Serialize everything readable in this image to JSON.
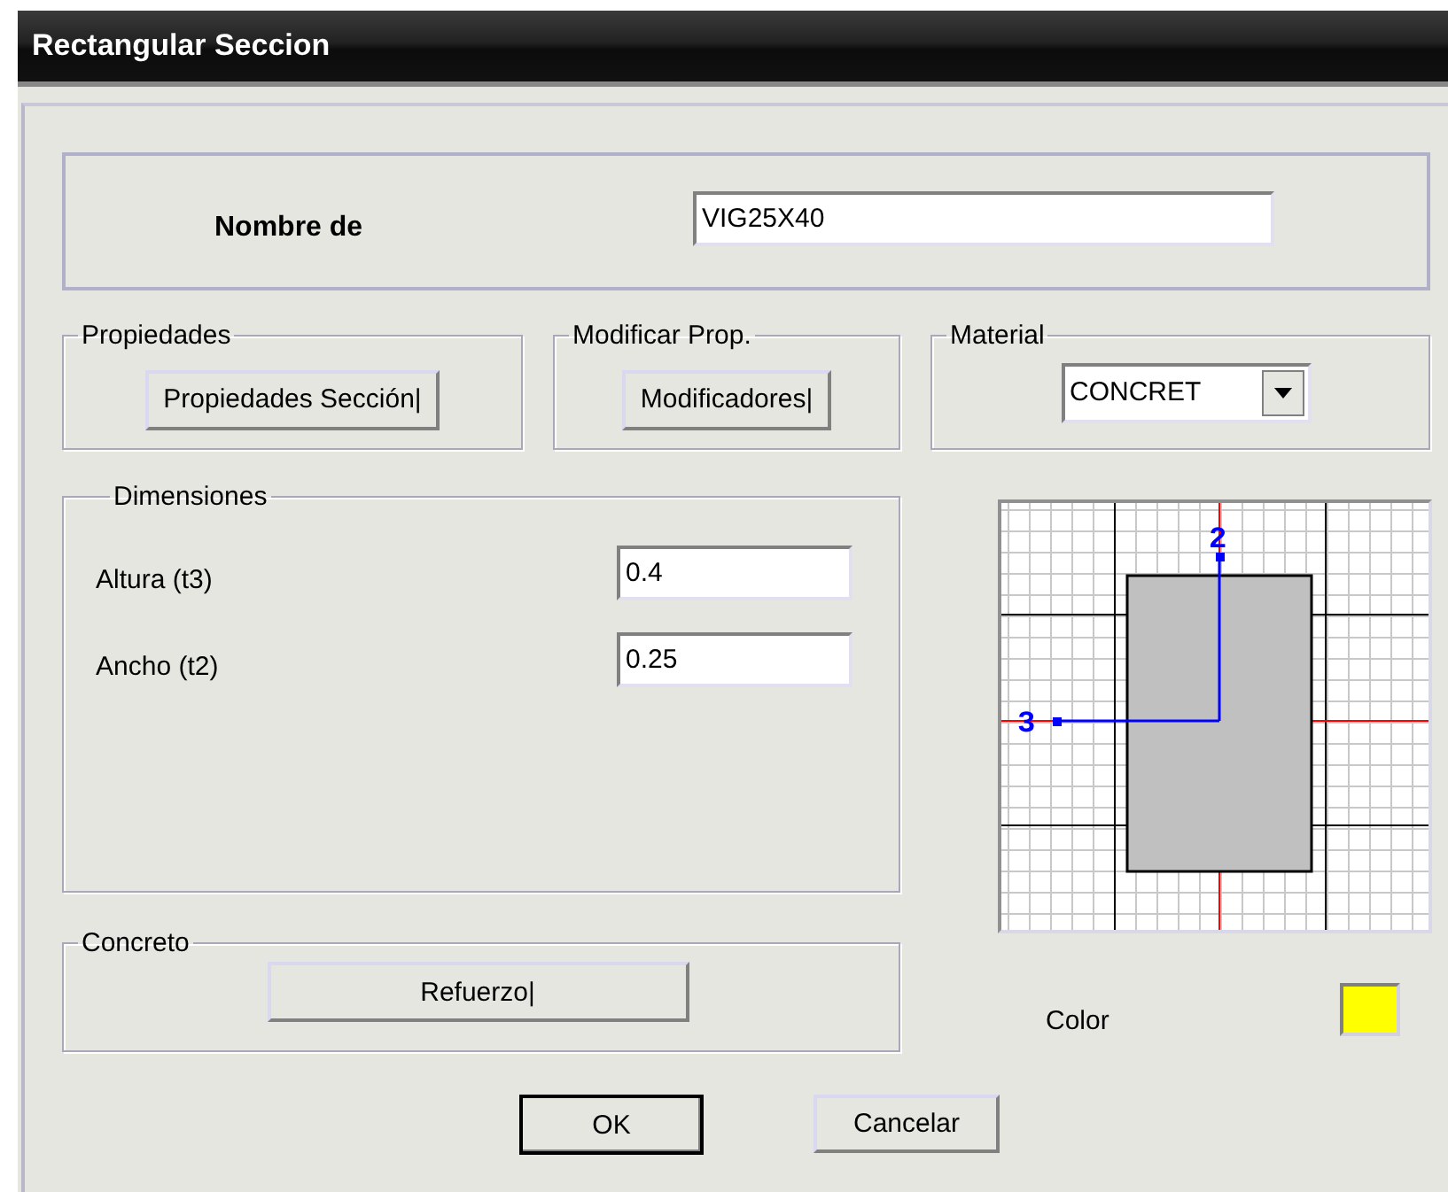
{
  "window": {
    "title": "Rectangular Seccion"
  },
  "name_group": {
    "label": "Nombre de",
    "value": "VIG25X40"
  },
  "groups": [
    {
      "title": "Propiedades",
      "button": "Propiedades Sección|"
    },
    {
      "title": "Modificar Prop.",
      "button": "Modificadores|"
    }
  ],
  "material": {
    "title": "Material",
    "value": "CONCRET"
  },
  "dimensions": {
    "title": "Dimensiones",
    "fields": [
      {
        "label": "Altura (t3)",
        "value": "0.4"
      },
      {
        "label": "Ancho (t2)",
        "value": "0.25"
      }
    ]
  },
  "concrete": {
    "title": "Concreto",
    "button": "Refuerzo|"
  },
  "diagram": {
    "axis_labels": [
      "2",
      "3"
    ]
  },
  "color": {
    "label": "Color",
    "color": "#ffff00"
  },
  "buttons": [
    {
      "label": "OK",
      "default": true
    },
    {
      "label": "Cancelar",
      "default": false
    }
  ]
}
